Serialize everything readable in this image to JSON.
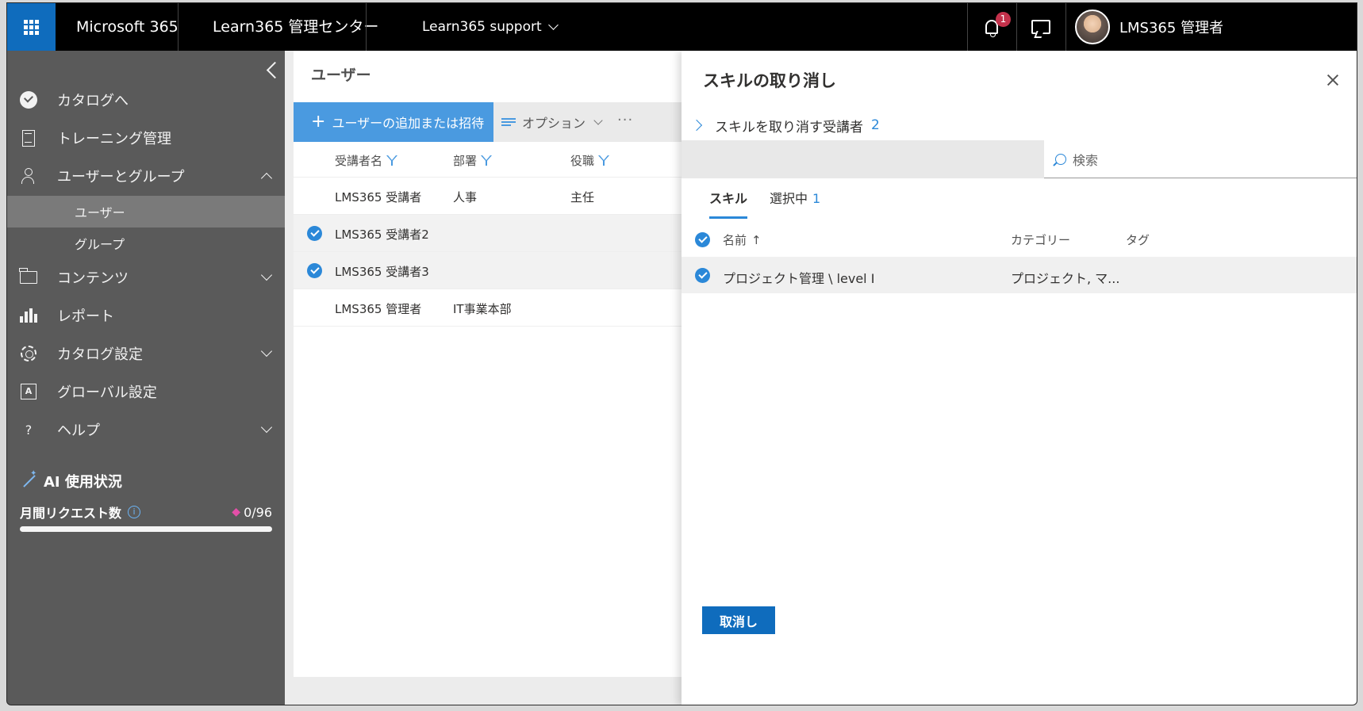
{
  "topbar": {
    "brand": "Microsoft 365",
    "center_title": "Learn365 管理センター",
    "tenant": "Learn365 support",
    "notification_count": "1",
    "user_name": "LMS365 管理者"
  },
  "sidebar": {
    "items": [
      {
        "label": "カタログへ",
        "icon": "circle-check-icon"
      },
      {
        "label": "トレーニング管理",
        "icon": "document-icon"
      },
      {
        "label": "ユーザーとグループ",
        "icon": "people-icon",
        "expanded": true
      },
      {
        "label": "コンテンツ",
        "icon": "folder-icon"
      },
      {
        "label": "レポート",
        "icon": "bar-chart-icon"
      },
      {
        "label": "カタログ設定",
        "icon": "gear-icon"
      },
      {
        "label": "グローバル設定",
        "icon": "global-settings-icon"
      },
      {
        "label": "ヘルプ",
        "icon": "help-icon",
        "glyph": "?"
      }
    ],
    "sub_items": [
      {
        "label": "ユーザー",
        "active": true
      },
      {
        "label": "グループ",
        "active": false
      }
    ],
    "ai": {
      "title": "AI 使用状況",
      "request_label": "月間リクエスト数",
      "info_glyph": "i",
      "request_count": "0/96",
      "usage_fraction": 0
    }
  },
  "main": {
    "title": "ユーザー",
    "add_button": "ユーザーの追加または招待",
    "options_button": "オプション",
    "more_glyph": "···",
    "columns": [
      "受講者名",
      "部署",
      "役職"
    ],
    "rows": [
      {
        "name": "LMS365 受講者",
        "department": "人事",
        "role": "主任",
        "selected": false
      },
      {
        "name": "LMS365 受講者2",
        "department": "",
        "role": "",
        "selected": true
      },
      {
        "name": "LMS365 受講者3",
        "department": "",
        "role": "",
        "selected": true
      },
      {
        "name": "LMS365 管理者",
        "department": "IT事業本部",
        "role": "",
        "selected": false
      }
    ]
  },
  "panel": {
    "title": "スキルの取り消し",
    "learners_label": "スキルを取り消す受講者",
    "learners_count": "2",
    "search_placeholder": "検索",
    "tabs": [
      {
        "label": "スキル",
        "count": ""
      },
      {
        "label": "選択中",
        "count": "1"
      }
    ],
    "columns": {
      "name": "名前",
      "sort_glyph": "↑",
      "category": "カテゴリー",
      "tags": "タグ"
    },
    "rows": [
      {
        "name": "プロジェクト管理 \\ level I",
        "category": "プロジェクト, マ...",
        "tags": ""
      }
    ],
    "cancel_button": "取消し"
  },
  "colors": {
    "accent": "#0f6cbd",
    "sidebar_bg": "#5a5a5a",
    "badge": "#c4314b"
  }
}
